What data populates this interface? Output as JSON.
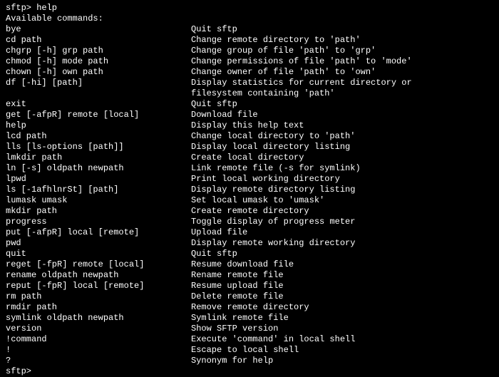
{
  "prompt1": "sftp> help",
  "header": "Available commands:",
  "rows": [
    {
      "cmd": "bye",
      "desc": "Quit sftp"
    },
    {
      "cmd": "cd path",
      "desc": "Change remote directory to 'path'"
    },
    {
      "cmd": "chgrp [-h] grp path",
      "desc": "Change group of file 'path' to 'grp'"
    },
    {
      "cmd": "chmod [-h] mode path",
      "desc": "Change permissions of file 'path' to 'mode'"
    },
    {
      "cmd": "chown [-h] own path",
      "desc": "Change owner of file 'path' to 'own'"
    },
    {
      "cmd": "df [-hi] [path]",
      "desc": "Display statistics for current directory or"
    },
    {
      "cmd": "",
      "desc": "filesystem containing 'path'"
    },
    {
      "cmd": "exit",
      "desc": "Quit sftp"
    },
    {
      "cmd": "get [-afpR] remote [local]",
      "desc": "Download file"
    },
    {
      "cmd": "help",
      "desc": "Display this help text"
    },
    {
      "cmd": "lcd path",
      "desc": "Change local directory to 'path'"
    },
    {
      "cmd": "lls [ls-options [path]]",
      "desc": "Display local directory listing"
    },
    {
      "cmd": "lmkdir path",
      "desc": "Create local directory"
    },
    {
      "cmd": "ln [-s] oldpath newpath",
      "desc": "Link remote file (-s for symlink)"
    },
    {
      "cmd": "lpwd",
      "desc": "Print local working directory"
    },
    {
      "cmd": "ls [-1afhlnrSt] [path]",
      "desc": "Display remote directory listing"
    },
    {
      "cmd": "lumask umask",
      "desc": "Set local umask to 'umask'"
    },
    {
      "cmd": "mkdir path",
      "desc": "Create remote directory"
    },
    {
      "cmd": "progress",
      "desc": "Toggle display of progress meter"
    },
    {
      "cmd": "put [-afpR] local [remote]",
      "desc": "Upload file"
    },
    {
      "cmd": "pwd",
      "desc": "Display remote working directory"
    },
    {
      "cmd": "quit",
      "desc": "Quit sftp"
    },
    {
      "cmd": "reget [-fpR] remote [local]",
      "desc": "Resume download file"
    },
    {
      "cmd": "rename oldpath newpath",
      "desc": "Rename remote file"
    },
    {
      "cmd": "reput [-fpR] local [remote]",
      "desc": "Resume upload file"
    },
    {
      "cmd": "rm path",
      "desc": "Delete remote file"
    },
    {
      "cmd": "rmdir path",
      "desc": "Remove remote directory"
    },
    {
      "cmd": "symlink oldpath newpath",
      "desc": "Symlink remote file"
    },
    {
      "cmd": "version",
      "desc": "Show SFTP version"
    },
    {
      "cmd": "!command",
      "desc": "Execute 'command' in local shell"
    },
    {
      "cmd": "!",
      "desc": "Escape to local shell"
    },
    {
      "cmd": "?",
      "desc": "Synonym for help"
    }
  ],
  "prompt2": "sftp>"
}
